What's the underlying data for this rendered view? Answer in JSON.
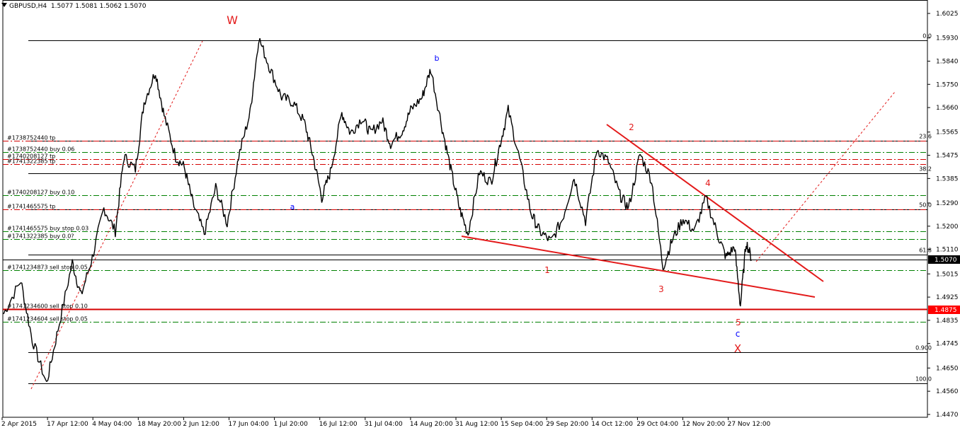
{
  "header": {
    "symbol_timeframe": "GBPUSD,H4",
    "ohlc": "1.5077 1.5081 1.5062 1.5070"
  },
  "colors": {
    "background": "#ffffff",
    "candles": "#000000",
    "wave_red": "#e31a1a",
    "wave_blue": "#0000ff",
    "level_green": "#008000",
    "level_red": "#d40000",
    "current_price_bg": "#000000",
    "stop_price_bg": "#ff0000"
  },
  "chart_data": {
    "type": "line",
    "instrument": "GBPUSD",
    "timeframe": "H4",
    "y_range": [
      1.44,
      1.605
    ],
    "y_ticks": [
      "1.6025",
      "1.5930",
      "1.5840",
      "1.5750",
      "1.5660",
      "1.5565",
      "1.5475",
      "1.5385",
      "1.5290",
      "1.5200",
      "1.5110",
      "1.5015",
      "1.4925",
      "1.4835",
      "1.4745",
      "1.4650",
      "1.4560",
      "1.4470"
    ],
    "x_ticks": [
      "2 Apr 2015",
      "17 Apr 12:00",
      "4 May 04:00",
      "18 May 20:00",
      "2 Jun 12:00",
      "17 Jun 04:00",
      "1 Jul 20:00",
      "16 Jul 12:00",
      "31 Jul 04:00",
      "14 Aug 20:00",
      "31 Aug 12:00",
      "15 Sep 04:00",
      "29 Sep 20:00",
      "14 Oct 12:00",
      "29 Oct 04:00",
      "12 Nov 20:00",
      "27 Nov 12:00"
    ],
    "price_path": [
      [
        0,
        1.486
      ],
      [
        6,
        1.499
      ],
      [
        10,
        1.476
      ],
      [
        15,
        1.459
      ],
      [
        19,
        1.48
      ],
      [
        24,
        1.506
      ],
      [
        27,
        1.493
      ],
      [
        31,
        1.508
      ],
      [
        35,
        1.527
      ],
      [
        39,
        1.518
      ],
      [
        42,
        1.547
      ],
      [
        46,
        1.542
      ],
      [
        49,
        1.568
      ],
      [
        53,
        1.58
      ],
      [
        56,
        1.563
      ],
      [
        60,
        1.547
      ],
      [
        63,
        1.543
      ],
      [
        66,
        1.529
      ],
      [
        70,
        1.517
      ],
      [
        74,
        1.535
      ],
      [
        78,
        1.521
      ],
      [
        82,
        1.547
      ],
      [
        86,
        1.564
      ],
      [
        89,
        1.593
      ],
      [
        93,
        1.581
      ],
      [
        97,
        1.57
      ],
      [
        101,
        1.568
      ],
      [
        105,
        1.56
      ],
      [
        108,
        1.547
      ],
      [
        111,
        1.531
      ],
      [
        114,
        1.541
      ],
      [
        118,
        1.564
      ],
      [
        121,
        1.556
      ],
      [
        125,
        1.562
      ],
      [
        128,
        1.556
      ],
      [
        132,
        1.561
      ],
      [
        135,
        1.552
      ],
      [
        139,
        1.557
      ],
      [
        142,
        1.565
      ],
      [
        146,
        1.57
      ],
      [
        149,
        1.581
      ],
      [
        153,
        1.558
      ],
      [
        156,
        1.542
      ],
      [
        159,
        1.527
      ],
      [
        162,
        1.517
      ],
      [
        166,
        1.541
      ],
      [
        170,
        1.537
      ],
      [
        173,
        1.551
      ],
      [
        176,
        1.565
      ],
      [
        180,
        1.546
      ],
      [
        184,
        1.525
      ],
      [
        187,
        1.518
      ],
      [
        191,
        1.514
      ],
      [
        195,
        1.523
      ],
      [
        199,
        1.539
      ],
      [
        203,
        1.522
      ],
      [
        207,
        1.55
      ],
      [
        211,
        1.545
      ],
      [
        215,
        1.532
      ],
      [
        218,
        1.527
      ],
      [
        222,
        1.548
      ],
      [
        226,
        1.538
      ],
      [
        230,
        1.504
      ],
      [
        233,
        1.514
      ],
      [
        237,
        1.523
      ],
      [
        241,
        1.518
      ],
      [
        245,
        1.531
      ],
      [
        249,
        1.517
      ],
      [
        252,
        1.508
      ],
      [
        255,
        1.512
      ],
      [
        257,
        1.489
      ],
      [
        259,
        1.514
      ],
      [
        261,
        1.507
      ]
    ],
    "price_path_range": [
      0,
      261
    ],
    "levels": [
      {
        "label": "#1738752440 tp",
        "price": 1.553,
        "style": "dashdot",
        "color": "red"
      },
      {
        "label": "#1738752440 buy 0.06",
        "price": 1.5487,
        "style": "dashdot",
        "color": "green"
      },
      {
        "label": "#1740208127 tp",
        "price": 1.546,
        "style": "dashdot",
        "color": "red"
      },
      {
        "label": "#1741322385 tp",
        "price": 1.544,
        "style": "dashdot",
        "color": "red"
      },
      {
        "label": "#1740208127 buy 0.10",
        "price": 1.532,
        "style": "dashdot",
        "color": "green"
      },
      {
        "label": "#1741465575 tp",
        "price": 1.5265,
        "style": "dashdot",
        "color": "red"
      },
      {
        "label": "#1741465575 buy stop 0.03",
        "price": 1.518,
        "style": "dashdot",
        "color": "green"
      },
      {
        "label": "#1741322385 buy 0.0?",
        "price": 1.515,
        "style": "dashdot",
        "color": "green"
      },
      {
        "label": "#1741234873 sell stop 0.05",
        "price": 1.503,
        "style": "dashdot",
        "color": "green"
      },
      {
        "label": "#1741234600 sell stop 0.10",
        "price": 1.488,
        "style": "dash",
        "color": "red"
      },
      {
        "label": "#1741234604 sell stop 0.05",
        "price": 1.483,
        "style": "dashdot",
        "color": "green"
      }
    ],
    "fibonacci": [
      {
        "label": "0.0",
        "price": 1.592
      },
      {
        "label": "23.6",
        "price": 1.553
      },
      {
        "label": "38.2",
        "price": 1.5405
      },
      {
        "label": "50.0",
        "price": 1.5265
      },
      {
        "label": "61.8",
        "price": 1.509
      },
      {
        "label": "0.900",
        "price": 1.471
      },
      {
        "label": "100.0",
        "price": 1.459
      }
    ],
    "horizontal_lines": [
      {
        "price": 1.488,
        "color": "red"
      },
      {
        "price": 1.507,
        "color": "black"
      }
    ],
    "price_markers": [
      {
        "label": "1.5070",
        "price": 1.507,
        "bg": "#000000"
      },
      {
        "label": "1.4875",
        "price": 1.4875,
        "bg": "#ff0000"
      }
    ],
    "wave_labels": [
      {
        "text": "W",
        "color": "red"
      },
      {
        "text": "a",
        "color": "blue"
      },
      {
        "text": "b",
        "color": "blue"
      },
      {
        "text": "1",
        "color": "red"
      },
      {
        "text": "2",
        "color": "red"
      },
      {
        "text": "3",
        "color": "red"
      },
      {
        "text": "4",
        "color": "red"
      },
      {
        "text": "5",
        "color": "red"
      },
      {
        "text": "c",
        "color": "blue"
      },
      {
        "text": "X",
        "color": "red"
      }
    ]
  }
}
